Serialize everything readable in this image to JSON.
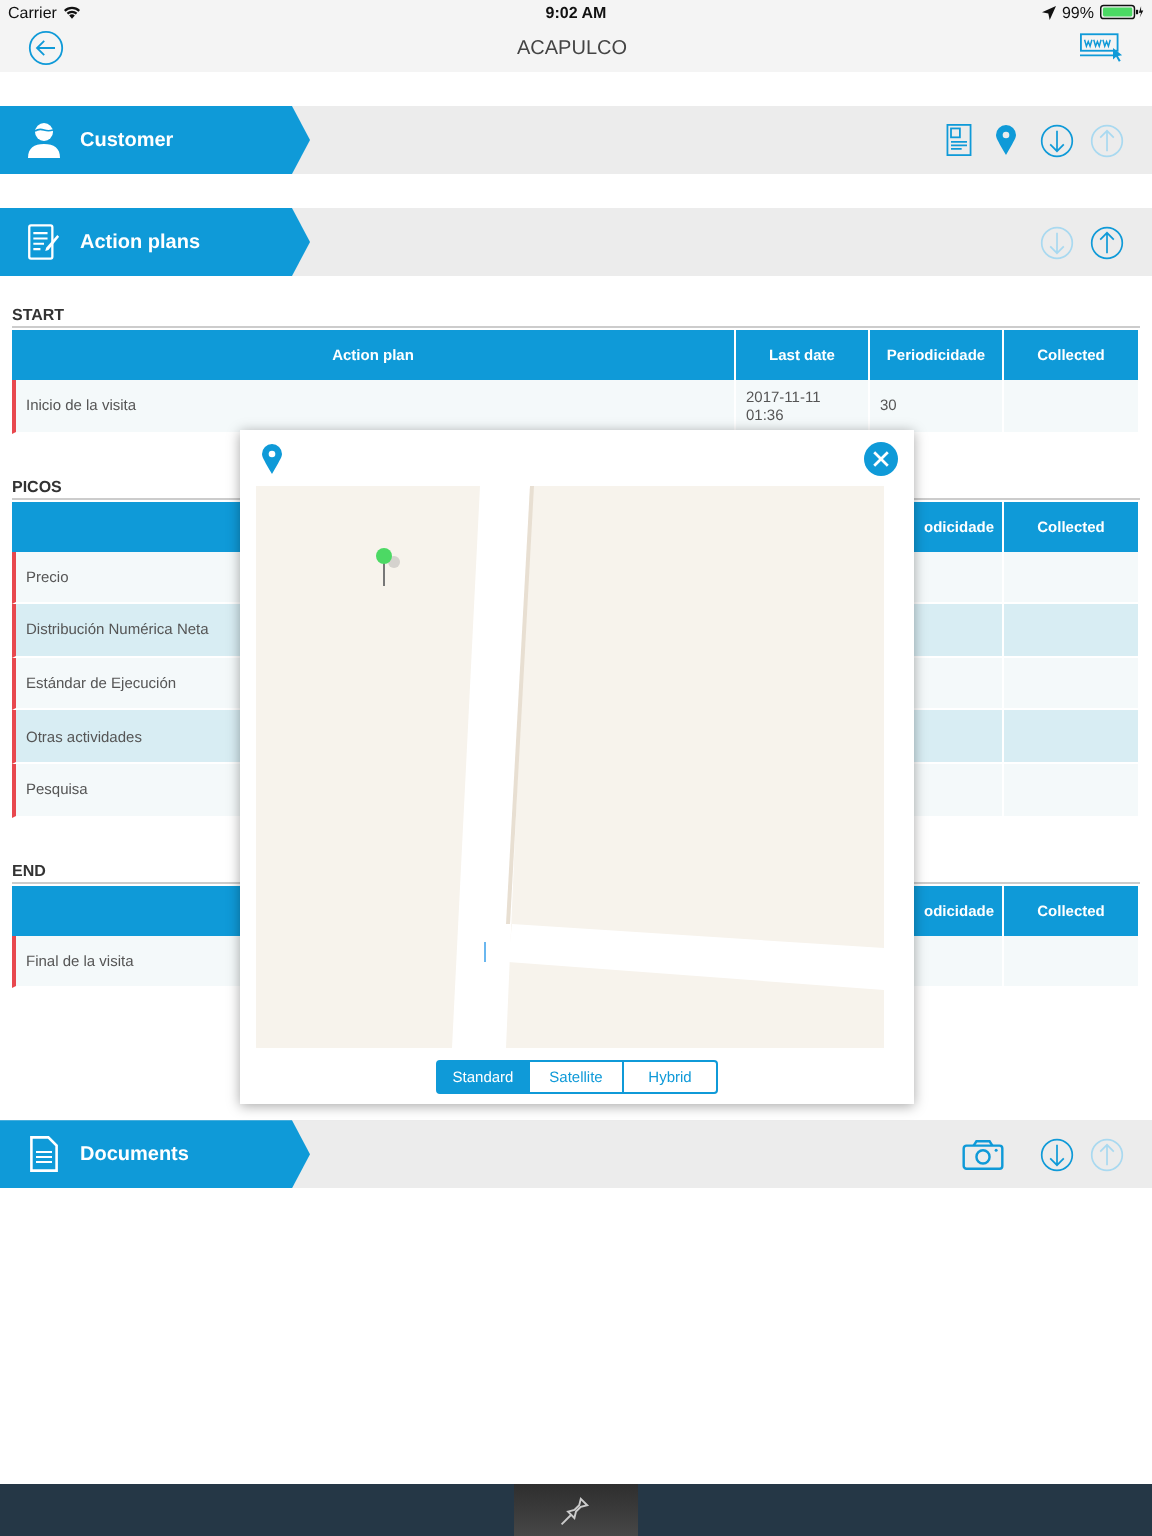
{
  "status_bar": {
    "carrier": "Carrier",
    "time": "9:02 AM",
    "battery": "99%"
  },
  "nav": {
    "title": "ACAPULCO"
  },
  "sections": [
    {
      "kind": "customer",
      "title": "Customer",
      "actions": [
        {
          "kind": "form",
          "disabled": false
        },
        {
          "kind": "location",
          "disabled": false
        },
        {
          "kind": "download",
          "disabled": false
        },
        {
          "kind": "upload",
          "disabled": true
        }
      ]
    },
    {
      "kind": "action_plans",
      "title": "Action plans",
      "actions": [
        {
          "kind": "download",
          "disabled": true
        },
        {
          "kind": "upload",
          "disabled": false
        }
      ],
      "groups": [
        {
          "title": "START",
          "columns": [
            "Action plan",
            "Last date",
            "Periodicidade",
            "Collected"
          ],
          "rows": [
            {
              "cells": [
                "Inicio de la visita",
                "2017-11-11\n01:36",
                "30"
              ]
            }
          ]
        },
        {
          "title": "PICOS",
          "columns": [
            "odicidade",
            "Collected"
          ],
          "rows": [
            {
              "cells": [
                "Precio"
              ]
            },
            {
              "cells": [
                "Distribución Numérica Neta"
              ]
            },
            {
              "cells": [
                "Estándar de Ejecución"
              ]
            },
            {
              "cells": [
                "Otras actividades"
              ]
            },
            {
              "cells": [
                "Pesquisa"
              ]
            }
          ]
        },
        {
          "title": "END",
          "columns": [
            "odicidade",
            "Collected"
          ],
          "rows": [
            {
              "cells": [
                "Final de la visita"
              ]
            }
          ]
        }
      ]
    },
    {
      "kind": "documents",
      "title": "Documents",
      "actions": [
        {
          "kind": "camera",
          "disabled": false
        },
        {
          "kind": "download",
          "disabled": false
        },
        {
          "kind": "upload",
          "disabled": true
        }
      ]
    }
  ],
  "map_popup": {
    "segments": [
      {
        "label": "Standard",
        "selected": true
      },
      {
        "label": "Satellite",
        "selected": false
      },
      {
        "label": "Hybrid",
        "selected": false
      }
    ]
  },
  "tab_bar": {
    "items": [
      {
        "kind": "pin",
        "selected": true
      }
    ]
  }
}
